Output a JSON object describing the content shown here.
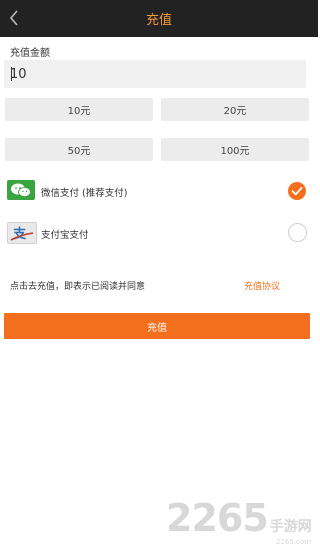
{
  "header": {
    "title": "充值"
  },
  "form": {
    "label": "充值金额",
    "amount_value": "10"
  },
  "amount_options": [
    "10元",
    "20元",
    "50元",
    "100元"
  ],
  "payment": {
    "wechat": {
      "label": "微信支付 (推荐支付)",
      "selected": true
    },
    "alipay": {
      "label": "支付宝支付",
      "selected": false
    }
  },
  "agreement": {
    "text": "点击去充值，即表示已阅读并同意",
    "link": "充值协议"
  },
  "submit_label": "充值",
  "watermark": {
    "number": "2265",
    "site": "手游网",
    "domain": "2265.com"
  },
  "colors": {
    "accent": "#f36f1d",
    "header_bg": "#222222",
    "header_text": "#f39a3b",
    "wechat_green": "#3aa540"
  }
}
